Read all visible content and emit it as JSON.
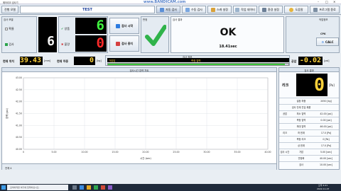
{
  "window": {
    "title": "에어리크 검사기",
    "watermark": "www.BANDICAM.com"
  },
  "toolbar": {
    "model_btn": "전행 모델",
    "model_name": "TEST",
    "auto_inspect": "자동 검사",
    "manual_inspect": "수동 검사",
    "screen_settings": "스캐 설정",
    "print_settings": "작업 데이터",
    "env_settings": "환경 설정",
    "help": "도움말",
    "exit": "프로그램 종료"
  },
  "status": {
    "check_lbl": "검사 모델",
    "ok_lbl": "확율",
    "pass_lbl": "검사",
    "good_lbl": "양품",
    "bad_lbl": "불량",
    "good_count": "6",
    "bad_count": "0",
    "pass_count": "6",
    "start_btn": "검사 시작",
    "stop_btn": "검사 중지",
    "judge_lbl": "판정",
    "result_lbl": "검사 결과",
    "result": "OK",
    "elapsed": "18.41sec",
    "sensor_lbl": "작업정보",
    "cpk_lbl": "CPK",
    "calc_btn": "CALC"
  },
  "readout": {
    "pos_lbl": "현재 위치",
    "pos_val": "39.43",
    "pos_unit": "[mm]",
    "load_lbl": "현재 하중",
    "load_val": "0",
    "load_unit": "[kg]",
    "step_lbl": "검사 정보",
    "step_name": "가압압",
    "step_sub": "측정 압력",
    "pressure_lbl": "공압",
    "pressure_val": "-0.02",
    "pressure_unit": "[psi]",
    "progress": 0.98
  },
  "graph": {
    "title": "검사시간 압력 차트",
    "xlabel": "시간 (sec)",
    "ylabel": "압력 (psi)",
    "bottom_note": "전체 4"
  },
  "chart_data": {
    "type": "line",
    "title": "검사시간 압력 차트",
    "xlabel": "시간 (sec)",
    "ylabel": "압력 (psi)",
    "xlim": [
      0,
      40
    ],
    "ylim": [
      40,
      43
    ],
    "x_ticks": [
      "0",
      "5.00",
      "10.00",
      "15.00",
      "20.00",
      "25.00",
      "30.00",
      "35.00",
      "40.00"
    ],
    "y_ticks": [
      "43.00",
      "42.50",
      "42.00",
      "41.50",
      "41.00",
      "40.50",
      "40.00"
    ],
    "series": [],
    "grid": true
  },
  "panel": {
    "title": "검사 결과",
    "leak_lbl": "리크",
    "leak_val": "0",
    "leak_unit": "[Pa]",
    "rows": [
      {
        "group": "",
        "name": "설정 하중",
        "value": "2050 [kg]"
      },
      {
        "group": "",
        "name": "검사 단계 진입 제품",
        "value": ""
      },
      {
        "group": "공압",
        "name": "최소 압력",
        "value": "42.00 [psi]"
      },
      {
        "group": "",
        "name": "측정 압력",
        "value": "0.00 [psi]"
      },
      {
        "group": "",
        "name": "최대 압력",
        "value": "46.00 [psi]"
      },
      {
        "group": "리크",
        "name": "하 한계",
        "value": "17.0 [Pa]"
      },
      {
        "group": "",
        "name": "측정 리크",
        "value": "0 [Pa]"
      },
      {
        "group": "",
        "name": "상 한계",
        "value": "17.0 [Pa]"
      },
      {
        "group": "검사 시간",
        "name": "가압",
        "value": "5.00 [sec]"
      },
      {
        "group": "",
        "name": "안정화",
        "value": "40.00 [sec]"
      },
      {
        "group": "",
        "name": "검사",
        "value": "10.00 [sec]"
      }
    ]
  },
  "taskbar": {
    "search_placeholder": "검색하려면 여기에 입력하십시오.",
    "time": "오후 4:21",
    "date": "2022-11-07"
  }
}
